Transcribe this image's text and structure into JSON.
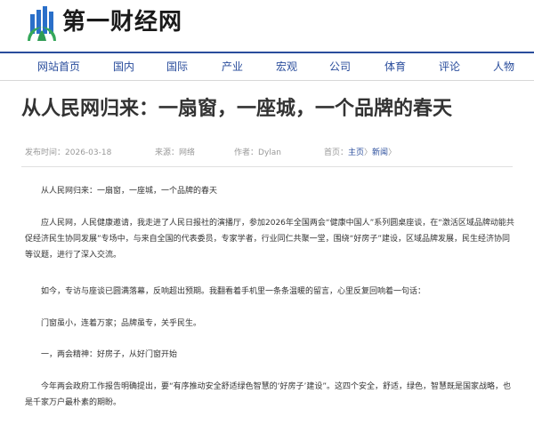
{
  "site": {
    "name": "第一财经网"
  },
  "nav": [
    "网站首页",
    "国内",
    "国际",
    "产业",
    "宏观",
    "公司",
    "体育",
    "评论",
    "人物"
  ],
  "article": {
    "title": "从人民网归来：一扇窗，一座城，一个品牌的春天",
    "meta": {
      "publish_label": "发布时间：",
      "publish_date": "2026-03-18",
      "source_label": "来源：",
      "source": "网络",
      "author_label": "作者：",
      "author": "Dylan",
      "breadcrumb_label": "首页：",
      "breadcrumb_home": "主页",
      "breadcrumb_sep": "〉",
      "breadcrumb_section": "新闻",
      "breadcrumb_end": "〉"
    },
    "paragraphs": [
      "从人民网归来：一扇窗，一座城，一个品牌的春天",
      "应人民网，人民健康邀请，我走进了人民日报社的演播厅，参加2026年全国两会“健康中国人”系列圆桌座谈，在“激活区域品牌动能共促经济民生协同发展”专场中，与来自全国的代表委员，专家学者，行业同仁共聚一堂，围绕“好房子”建设，区域品牌发展，民生经济协同等议题，进行了深入交流。",
      "如今，专访与座谈已圆满落幕，反响超出预期。我翻看着手机里一条条温暖的留言，心里反复回响着一句话：",
      "门窗虽小，连着万家；品牌虽专，关乎民生。",
      "一，两会精神：好房子，从好门窗开始",
      "今年两会政府工作报告明确提出，要“有序推动安全舒适绿色智慧的‘好房子’建设”。这四个安全，舒适，绿色，智慧既是国家战略，也是千家万户最朴素的期盼。"
    ]
  },
  "colors": {
    "nav_accent": "#2a4d9c",
    "logo_blue": "#2a6fc9",
    "logo_green": "#35a85a"
  }
}
